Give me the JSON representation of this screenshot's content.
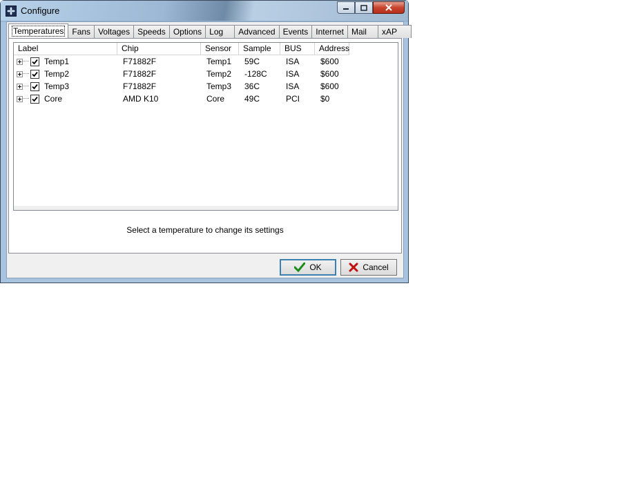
{
  "window": {
    "title": "Configure"
  },
  "tabs": [
    {
      "label": "Temperatures",
      "active": true
    },
    {
      "label": "Fans"
    },
    {
      "label": "Voltages"
    },
    {
      "label": "Speeds"
    },
    {
      "label": "Options"
    },
    {
      "label": "Log"
    },
    {
      "label": "Advanced"
    },
    {
      "label": "Events"
    },
    {
      "label": "Internet"
    },
    {
      "label": "Mail"
    },
    {
      "label": "xAP"
    }
  ],
  "table": {
    "columns": [
      "Label",
      "Chip",
      "Sensor",
      "Sample",
      "BUS",
      "Address"
    ],
    "rows": [
      {
        "checked": true,
        "label": "Temp1",
        "chip": "F71882F",
        "sensor": "Temp1",
        "sample": "59C",
        "bus": "ISA",
        "address": "$600"
      },
      {
        "checked": true,
        "label": "Temp2",
        "chip": "F71882F",
        "sensor": "Temp2",
        "sample": "-128C",
        "bus": "ISA",
        "address": "$600"
      },
      {
        "checked": true,
        "label": "Temp3",
        "chip": "F71882F",
        "sensor": "Temp3",
        "sample": "36C",
        "bus": "ISA",
        "address": "$600"
      },
      {
        "checked": true,
        "label": "Core",
        "chip": "AMD K10",
        "sensor": "Core",
        "sample": "49C",
        "bus": "PCI",
        "address": "$0"
      }
    ]
  },
  "hint": "Select a temperature to change its settings",
  "buttons": {
    "ok": "OK",
    "cancel": "Cancel"
  },
  "icons": {
    "ok": "check-icon",
    "cancel": "x-icon",
    "ok_color": "#1a8c1a",
    "cancel_color": "#c01010"
  }
}
